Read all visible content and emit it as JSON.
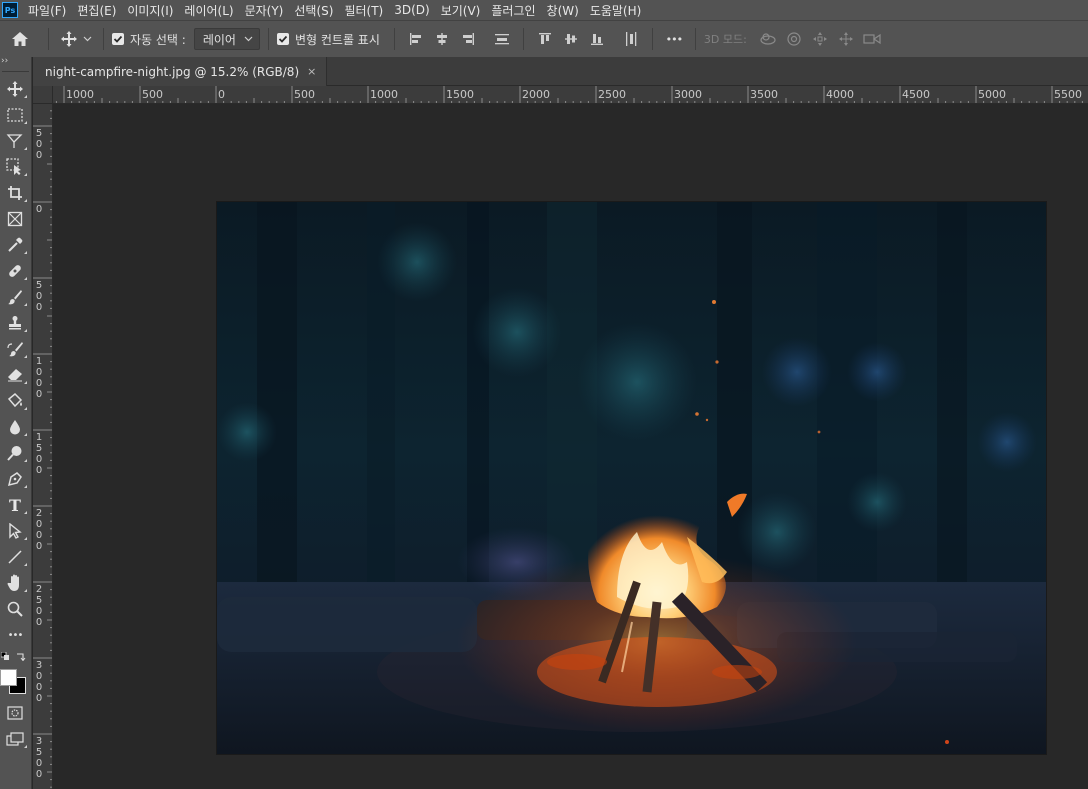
{
  "app": {
    "logo_text": "Ps"
  },
  "menu": [
    {
      "label": "파일(F)"
    },
    {
      "label": "편집(E)"
    },
    {
      "label": "이미지(I)"
    },
    {
      "label": "레이어(L)"
    },
    {
      "label": "문자(Y)"
    },
    {
      "label": "선택(S)"
    },
    {
      "label": "필터(T)"
    },
    {
      "label": "3D(D)"
    },
    {
      "label": "보기(V)"
    },
    {
      "label": "플러그인"
    },
    {
      "label": "창(W)"
    },
    {
      "label": "도움말(H)"
    }
  ],
  "options": {
    "auto_select_checked": true,
    "auto_select_label": "자동 선택 :",
    "auto_select_target": "레이어",
    "transform_controls_checked": true,
    "transform_controls_label": "변형 컨트롤 표시",
    "more_label": "•••",
    "mode_3d_label": "3D 모드:"
  },
  "toolbar": {
    "grip_label": "››",
    "tools": [
      {
        "name": "move-tool-icon"
      },
      {
        "name": "rectangular-marquee-tool-icon"
      },
      {
        "name": "lasso-tool-icon"
      },
      {
        "name": "object-selection-tool-icon"
      },
      {
        "name": "crop-tool-icon"
      },
      {
        "name": "frame-tool-icon"
      },
      {
        "name": "eyedropper-tool-icon"
      },
      {
        "name": "healing-brush-tool-icon"
      },
      {
        "name": "brush-tool-icon"
      },
      {
        "name": "clone-stamp-tool-icon"
      },
      {
        "name": "history-brush-tool-icon"
      },
      {
        "name": "eraser-tool-icon"
      },
      {
        "name": "paint-bucket-tool-icon"
      },
      {
        "name": "blur-tool-icon"
      },
      {
        "name": "dodge-tool-icon"
      },
      {
        "name": "pen-tool-icon"
      },
      {
        "name": "type-tool-icon",
        "text": "T"
      },
      {
        "name": "path-selection-tool-icon"
      },
      {
        "name": "line-tool-icon"
      },
      {
        "name": "hand-tool-icon"
      },
      {
        "name": "zoom-tool-icon"
      },
      {
        "name": "edit-toolbar-icon",
        "text": "•••"
      }
    ],
    "foreground_color": "#ffffff",
    "background_color": "#000000"
  },
  "document": {
    "tab_title": "night-campfire-night.jpg @ 15.2% (RGB/8)",
    "close_glyph": "×"
  },
  "rulers": {
    "horizontal": [
      "1000",
      "500",
      "0",
      "500",
      "1000",
      "1500",
      "2000",
      "2500",
      "3000",
      "3500",
      "4000",
      "4500",
      "5000",
      "5500"
    ],
    "vertical": [
      "500",
      "0",
      "500",
      "1000",
      "1500",
      "2000",
      "2500",
      "3000",
      "3500"
    ]
  },
  "colors": {
    "ui_panel": "#535353",
    "workspace": "#282828",
    "ruler": "#3c3c3c",
    "accent": "#31a8ff"
  }
}
